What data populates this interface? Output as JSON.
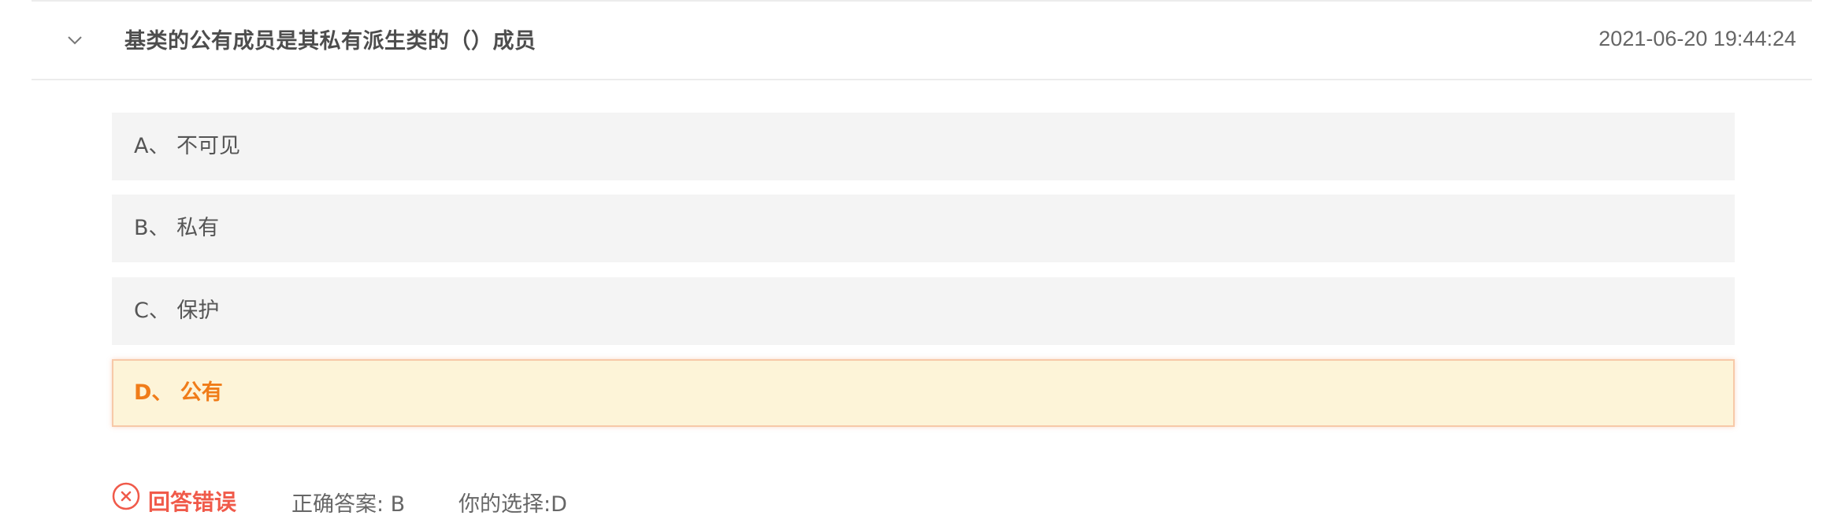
{
  "question": {
    "title": "基类的公有成员是其私有派生类的（）成员",
    "timestamp": "2021-06-20 19:44:24",
    "expand_icon": "chevron-down-icon"
  },
  "options": [
    {
      "label": "A、 不可见"
    },
    {
      "label": "B、 私有"
    },
    {
      "label": "C、 保护"
    },
    {
      "label": "D、 公有"
    }
  ],
  "result": {
    "icon": "close-circle-icon",
    "status": "回答错误",
    "correct_answer": "正确答案: B",
    "your_choice": "你的选择:D"
  },
  "colors": {
    "selected_bg": "#fdf4d8",
    "selected_text": "#f07c19",
    "wrong": "#f05a4a",
    "option_bg": "#f4f4f4"
  }
}
